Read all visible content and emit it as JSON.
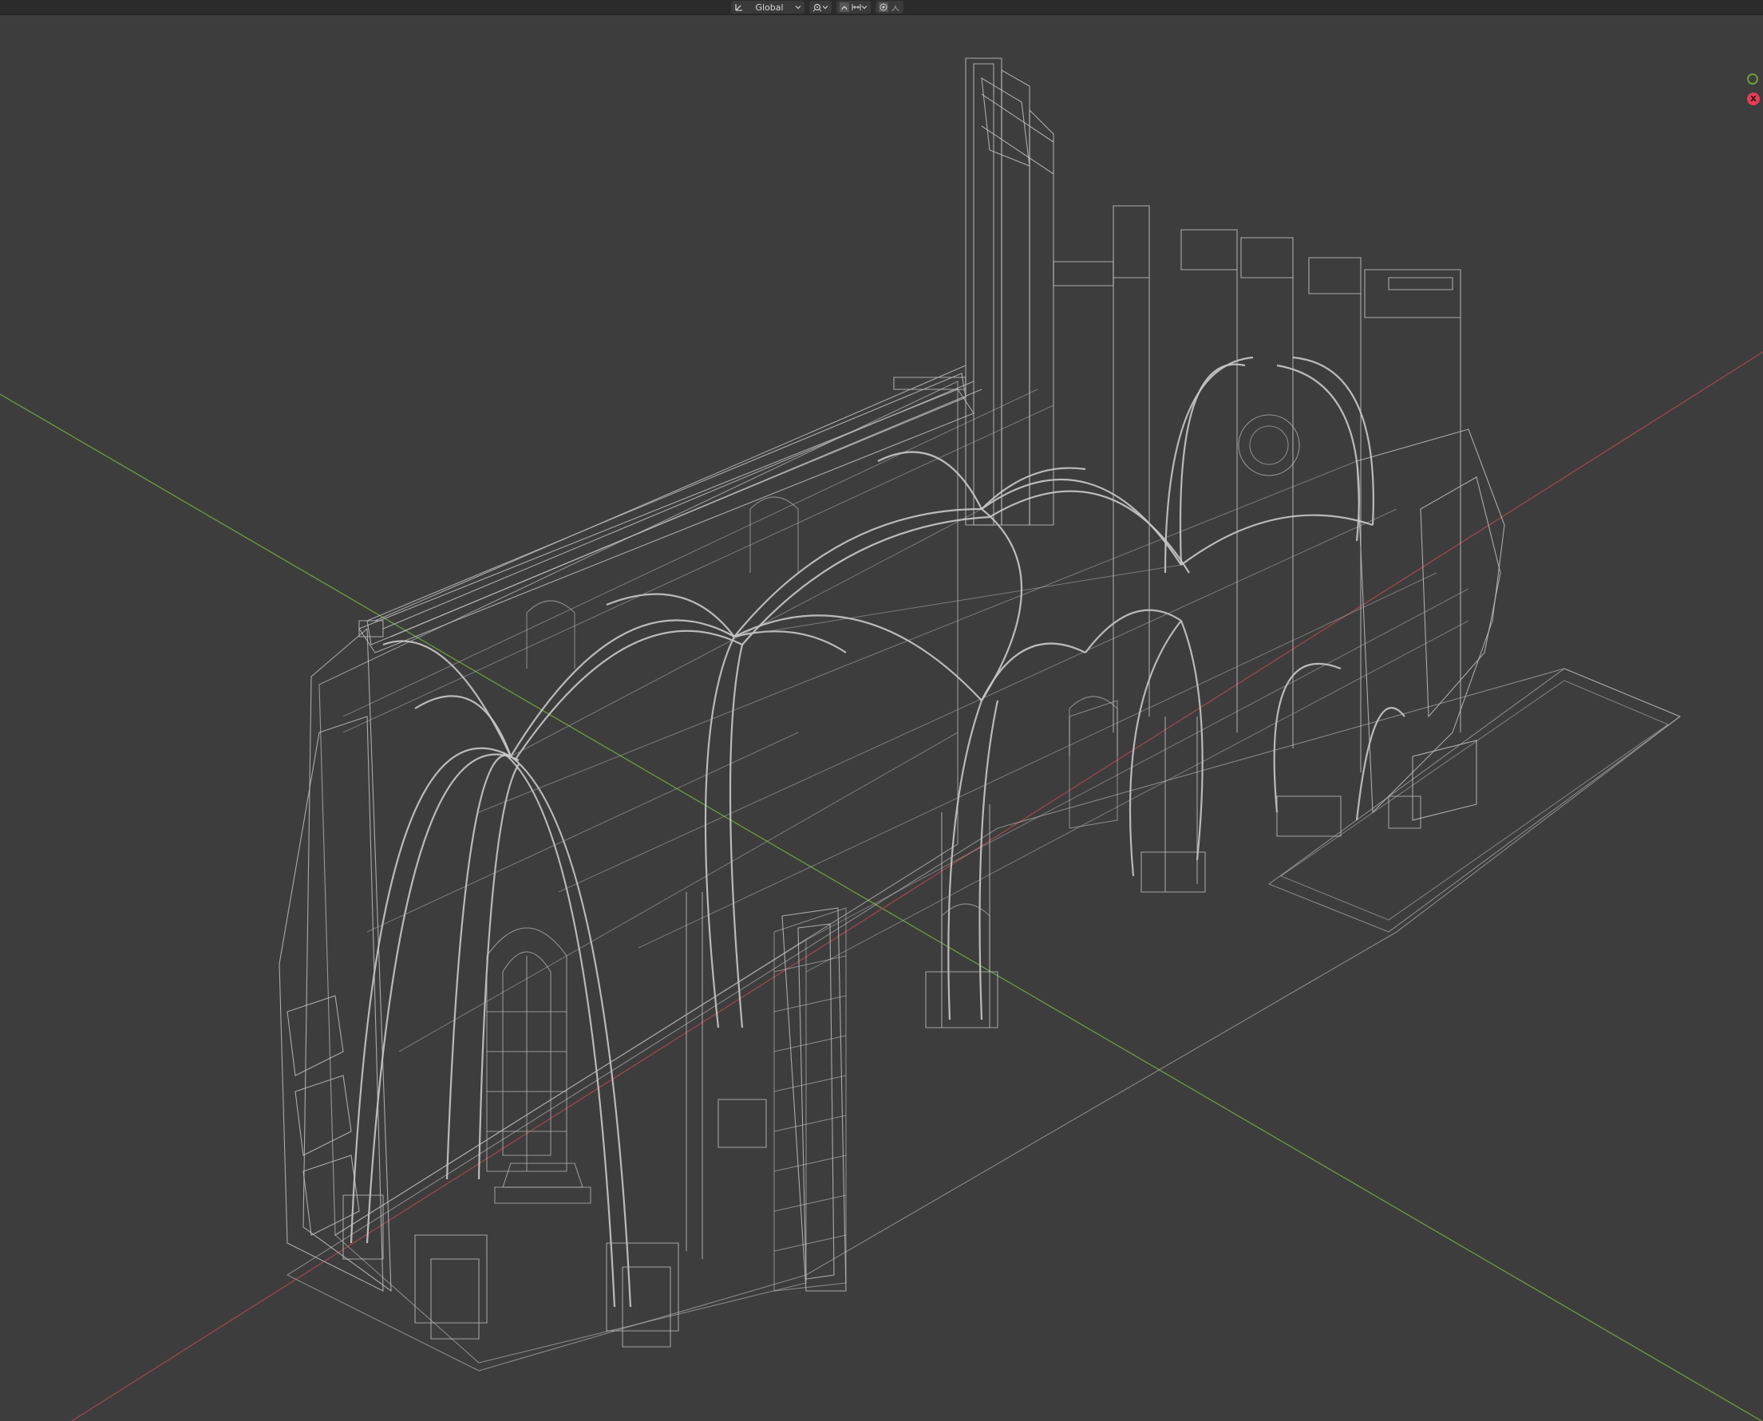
{
  "header": {
    "transform_orientation": {
      "value": "Global",
      "icon": "transform-orientation-icon"
    },
    "pivot_icon": "pivot-point-icon",
    "snap_icon": "snap-icon",
    "snap_target_icon": "snap-target-icon",
    "proportional_icon": "proportional-editing-icon",
    "falloff_icon": "falloff-curve-icon"
  },
  "viewport": {
    "background_color": "#3d3d3d",
    "axis_x_color": "#a0454f",
    "axis_y_color": "#6e9c3a",
    "wire_color": "#bdbdbd"
  },
  "gizmo": {
    "x_label": "X",
    "x_color": "#e43d58",
    "y_color": "#6e9c3a"
  }
}
